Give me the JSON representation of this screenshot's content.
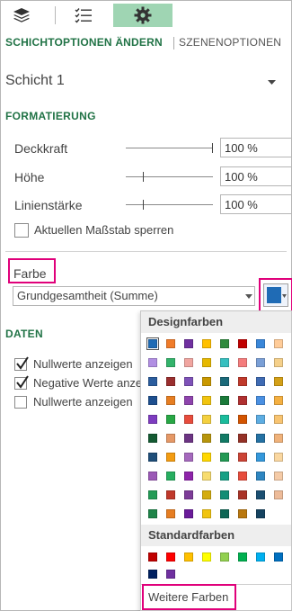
{
  "pane": {
    "tab_active": "SCHICHTOPTIONEN ÄNDERN",
    "tab_other": "SZENENOPTIONEN",
    "layer_select": "Schicht 1"
  },
  "formatting": {
    "heading": "FORMATIERUNG",
    "opacity_label": "Deckkraft",
    "opacity_value": "100 %",
    "opacity_level": 1.0,
    "height_label": "Höhe",
    "height_value": "100 %",
    "height_level": 0.1,
    "thickness_label": "Linienstärke",
    "thickness_value": "100 %",
    "thickness_level": 0.1,
    "lock_scale_label": "Aktuellen Maßstab sperren"
  },
  "color": {
    "label": "Farbe",
    "field_select": "Grundgesamtheit (Summe)",
    "current_color": "#1f6bb5"
  },
  "data": {
    "heading": "DATEN",
    "items": [
      {
        "label": "Nullwerte anzeigen",
        "checked": true
      },
      {
        "label": "Negative Werte anze",
        "checked": true
      },
      {
        "label": "Nullwerte anzeigen",
        "checked": false
      }
    ]
  },
  "palette": {
    "design_heading": "Designfarben",
    "standard_heading": "Standardfarben",
    "more_colors": "Weitere Farben",
    "design_colors": [
      [
        "#1f6bb5",
        "#f07c2a",
        "#7030a0",
        "#ffc000",
        "#2e8b3d",
        "#c00000",
        "#3a87d9",
        "#ffcc99"
      ],
      [
        "#b18fe3",
        "#33b36b",
        "#f0a5a0",
        "#e6b800",
        "#36bfbf",
        "#f47c7c",
        "#7a9fd6",
        "#f5d08a"
      ],
      [
        "#2b5d9e",
        "#9a2f2f",
        "#7e52b8",
        "#c99800",
        "#1b6a7a",
        "#c0392b",
        "#3f6bb3",
        "#d4a017"
      ],
      [
        "#1e4f8f",
        "#e67e22",
        "#8e44ad",
        "#f1c40f",
        "#1a7a3a",
        "#b03030",
        "#4a90e2",
        "#f5b041"
      ],
      [
        "#7d3cc0",
        "#28a745",
        "#e74c3c",
        "#f4d03f",
        "#1abc9c",
        "#d35400",
        "#5dade2",
        "#f8c471"
      ],
      [
        "#145a32",
        "#e59866",
        "#6c3483",
        "#b7950b",
        "#117a65",
        "#943126",
        "#2471a3",
        "#f0b27a"
      ],
      [
        "#1f4e79",
        "#f39c12",
        "#a569bd",
        "#ffd700",
        "#229954",
        "#cb4335",
        "#3498db",
        "#fad7a0"
      ],
      [
        "#9b59b6",
        "#27ae60",
        "#8e24aa",
        "#f7dc6f",
        "#16a085",
        "#e74c3c",
        "#2e86c1",
        "#f5cba7"
      ],
      [
        "#239b56",
        "#c0392b",
        "#7d3c98",
        "#d4ac0d",
        "#138d75",
        "#a93226",
        "#1b4f72",
        "#edbb99"
      ],
      [
        "#1e8449",
        "#e67e22",
        "#6a1b9a",
        "#f1c40f",
        "#0e6655",
        "#b9770e",
        "#154360"
      ]
    ],
    "standard_colors": [
      [
        "#c00000",
        "#ff0000",
        "#ffc000",
        "#ffff00",
        "#92d050",
        "#00b050",
        "#00b0f0",
        "#0070c0"
      ],
      [
        "#002060",
        "#7030a0"
      ]
    ]
  }
}
